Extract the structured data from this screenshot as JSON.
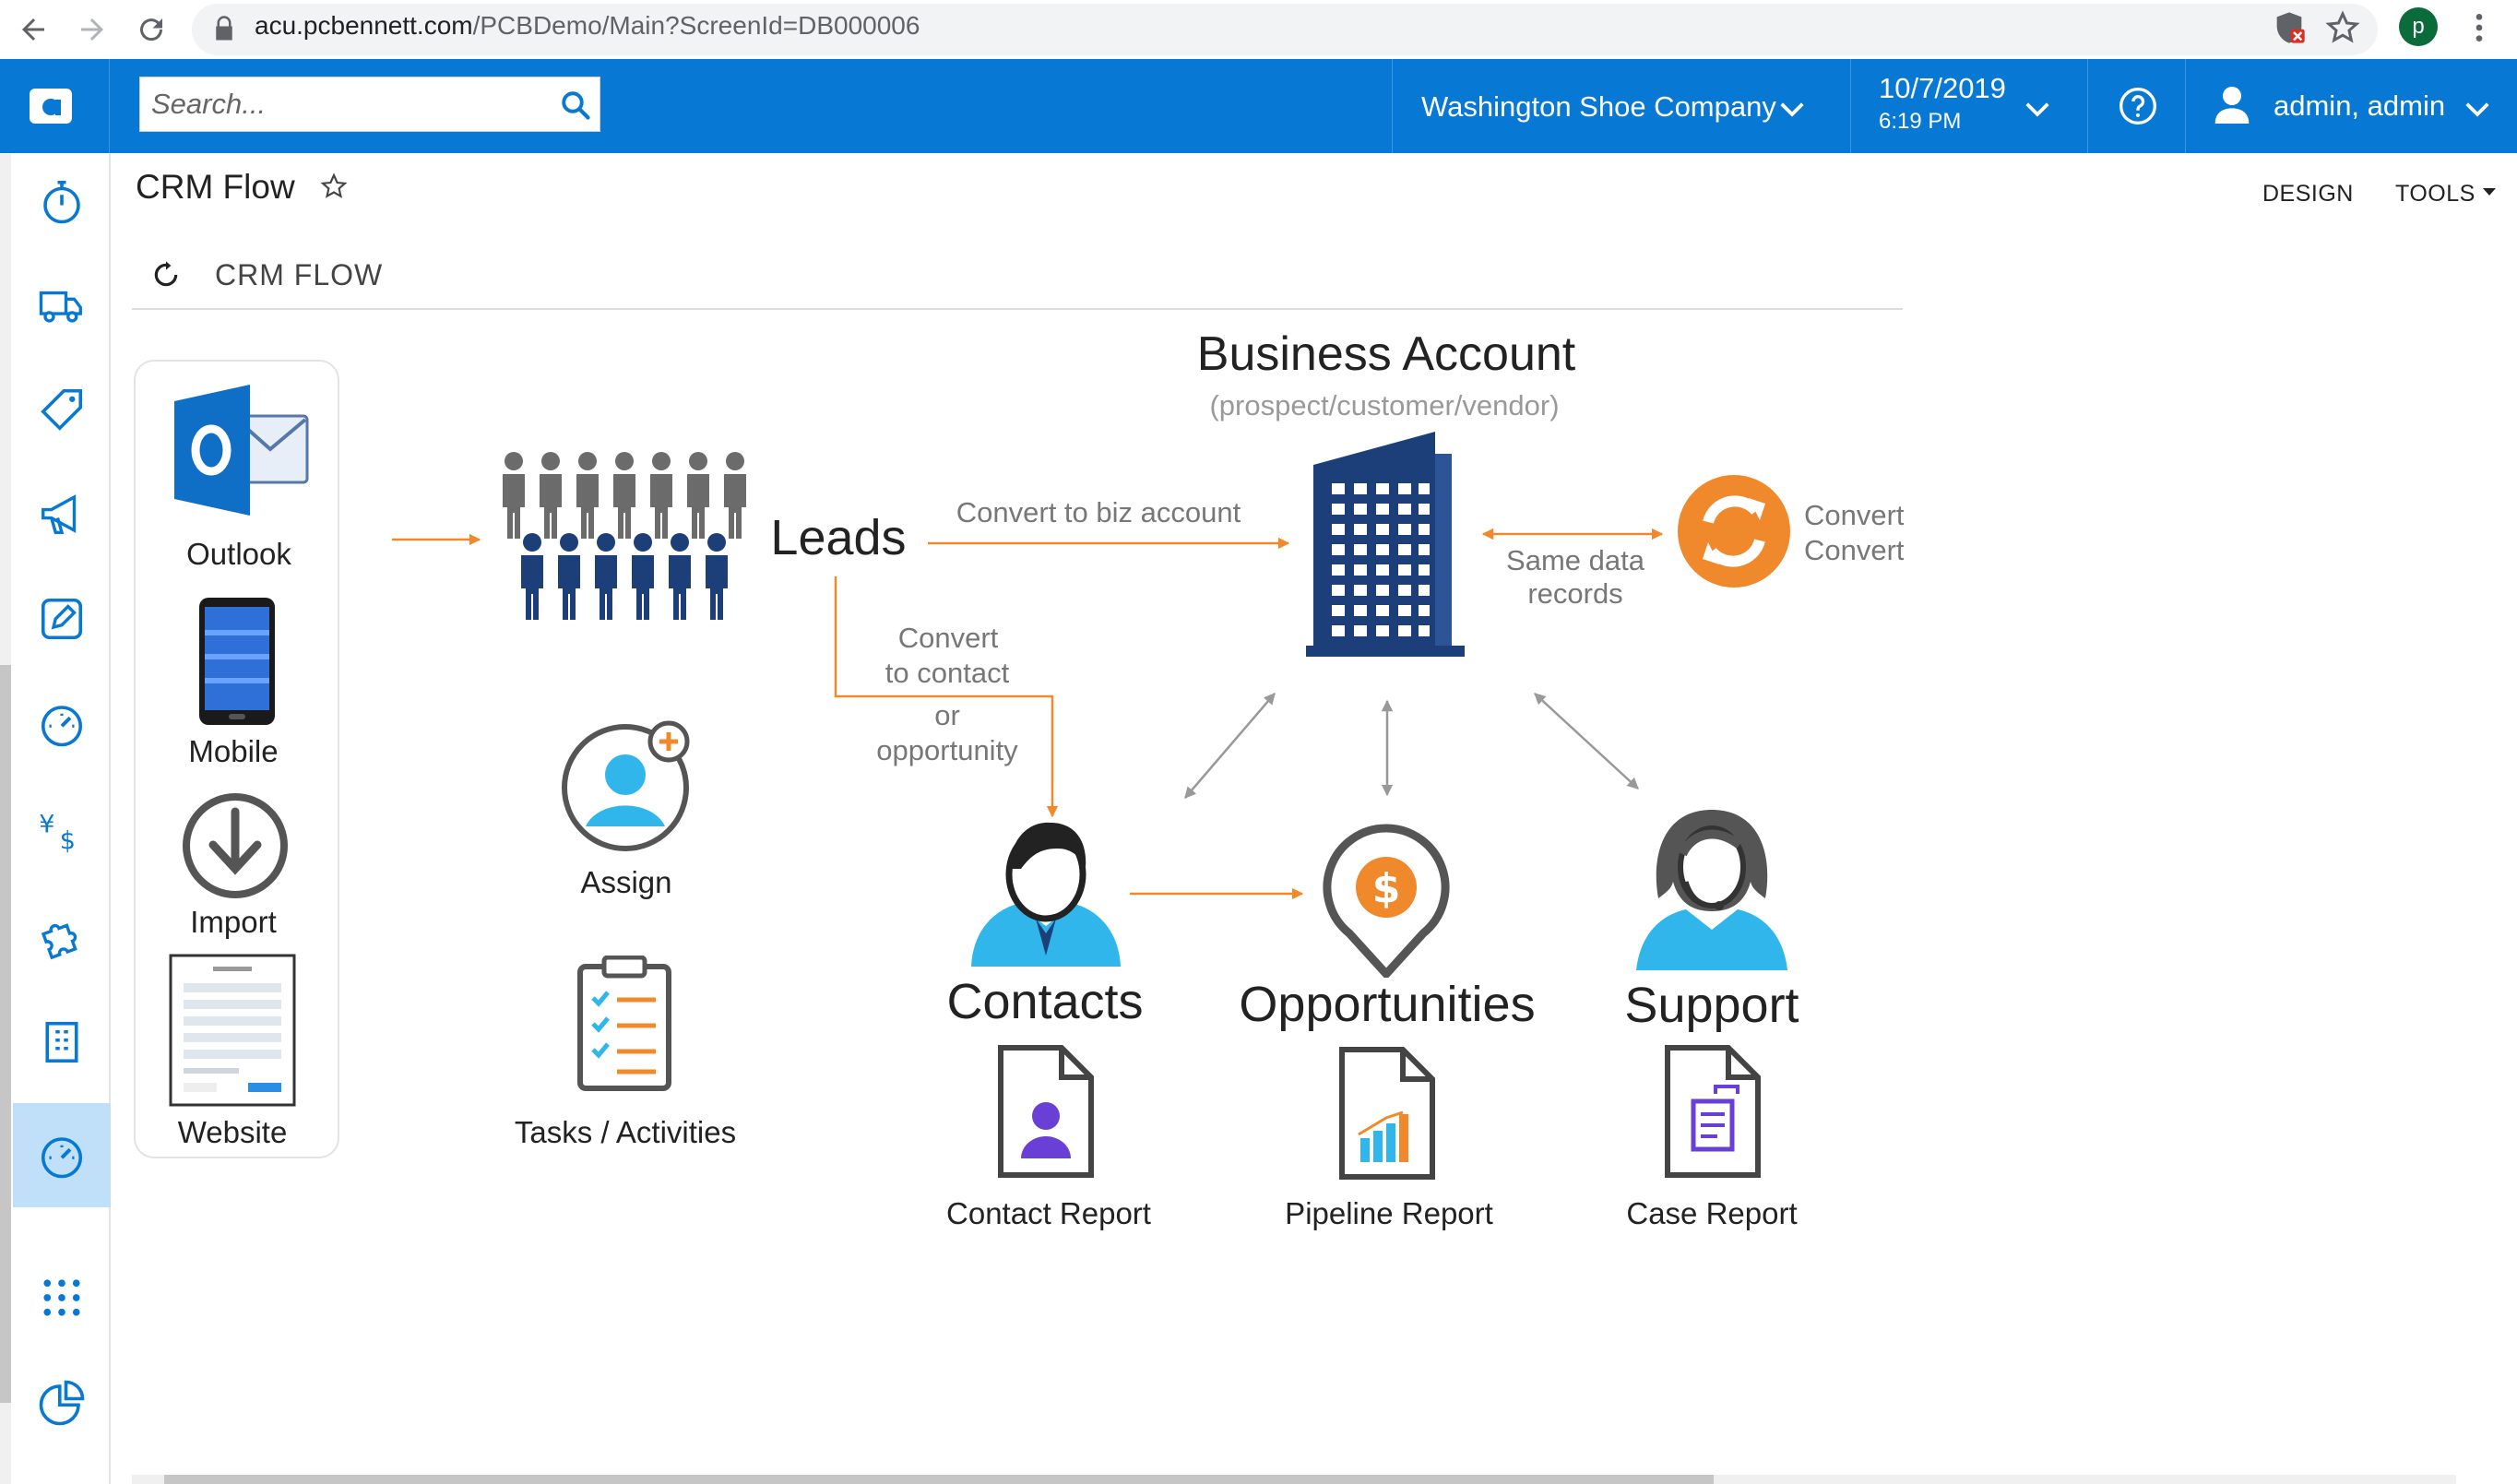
{
  "browser": {
    "url_host": "acu.pcbennett.com",
    "url_path": "/PCBDemo/Main?ScreenId=DB000006",
    "profile_initial": "p"
  },
  "header": {
    "search_placeholder": "Search...",
    "company": "Washington Shoe Company",
    "date": "10/7/2019",
    "time": "6:19 PM",
    "user": "admin, admin"
  },
  "sidebar": {
    "items": [
      {
        "icon": "stopwatch-icon"
      },
      {
        "icon": "truck-icon"
      },
      {
        "icon": "tag-icon"
      },
      {
        "icon": "megaphone-icon"
      },
      {
        "icon": "edit-icon"
      },
      {
        "icon": "dashboard-icon"
      },
      {
        "icon": "currency-icon"
      },
      {
        "icon": "puzzle-icon"
      },
      {
        "icon": "building-icon"
      },
      {
        "icon": "dashboard-active-icon"
      },
      {
        "icon": "apps-grid-icon"
      },
      {
        "icon": "pie-chart-icon"
      }
    ]
  },
  "page": {
    "title": "CRM Flow",
    "design_label": "DESIGN",
    "tools_label": "TOOLS",
    "section_title": "CRM FLOW"
  },
  "diagram": {
    "sources": {
      "outlook": "Outlook",
      "mobile": "Mobile",
      "import": "Import",
      "website": "Website"
    },
    "leads": "Leads",
    "assign": "Assign",
    "tasks": "Tasks / Activities",
    "convert_biz": "Convert to biz account",
    "convert_contact_1": "Convert",
    "convert_contact_2": "to contact",
    "convert_contact_3": "or",
    "convert_contact_4": "opportunity",
    "business_account": "Business Account",
    "business_account_sub": "(prospect/customer/vendor)",
    "same_data_1": "Same data",
    "same_data_2": "records",
    "convert_right_1": "Convert",
    "convert_right_2": "Convert",
    "contacts": "Contacts",
    "opportunities": "Opportunities",
    "support": "Support",
    "contact_report": "Contact Report",
    "pipeline_report": "Pipeline Report",
    "case_report": "Case Report"
  },
  "colors": {
    "header_blue": "#0778d4",
    "orange": "#f0892c",
    "navy": "#1c3f7a",
    "cyan": "#30b6ea"
  }
}
